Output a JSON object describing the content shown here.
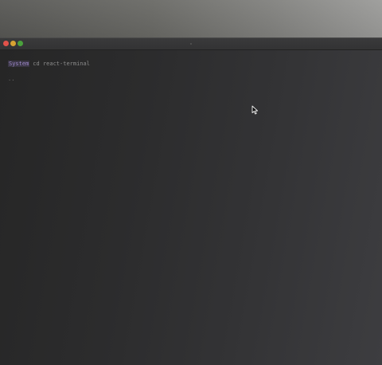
{
  "terminal": {
    "lines": [
      {
        "user": "System",
        "command": "cd react-terminal"
      },
      {
        "text": ".."
      }
    ]
  },
  "colors": {
    "traffic_close": "#e2524a",
    "traffic_minimize": "#d7a232",
    "traffic_zoom": "#4aa13c",
    "prompt_user": "#9b86c7"
  },
  "icons": [
    "close-button",
    "minimize-button",
    "zoom-button",
    "mouse-pointer-icon"
  ]
}
